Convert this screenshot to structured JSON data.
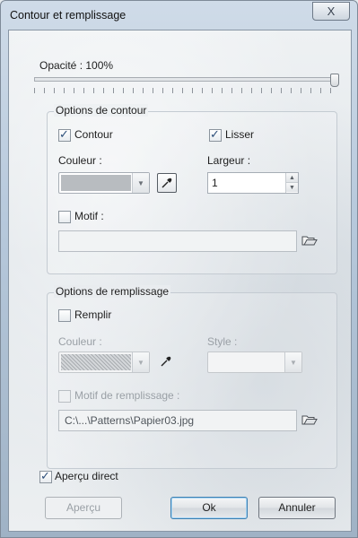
{
  "window": {
    "title": "Contour et remplissage",
    "close_label": "X"
  },
  "opacity": {
    "label": "Opacité : 100%",
    "value_percent": 100
  },
  "stroke": {
    "group_label": "Options de contour",
    "contour_label": "Contour",
    "contour_checked": true,
    "lisser_label": "Lisser",
    "lisser_checked": true,
    "color_label": "Couleur :",
    "width_label": "Largeur :",
    "width_value": "1",
    "motif_label": "Motif :",
    "motif_checked": false,
    "motif_path": ""
  },
  "fill": {
    "group_label": "Options de remplissage",
    "remplir_label": "Remplir",
    "remplir_checked": false,
    "color_label": "Couleur :",
    "style_label": "Style :",
    "motif_label": "Motif de remplissage :",
    "motif_checked": false,
    "motif_path": "C:\\...\\Patterns\\Papier03.jpg"
  },
  "preview": {
    "label": "Aperçu direct",
    "checked": true
  },
  "buttons": {
    "apercu": "Aperçu",
    "ok": "Ok",
    "cancel": "Annuler"
  },
  "icons": {
    "close": "close-icon",
    "pipette": "eyedropper-icon",
    "folder": "open-folder-icon",
    "dropdown": "chevron-down-icon"
  }
}
